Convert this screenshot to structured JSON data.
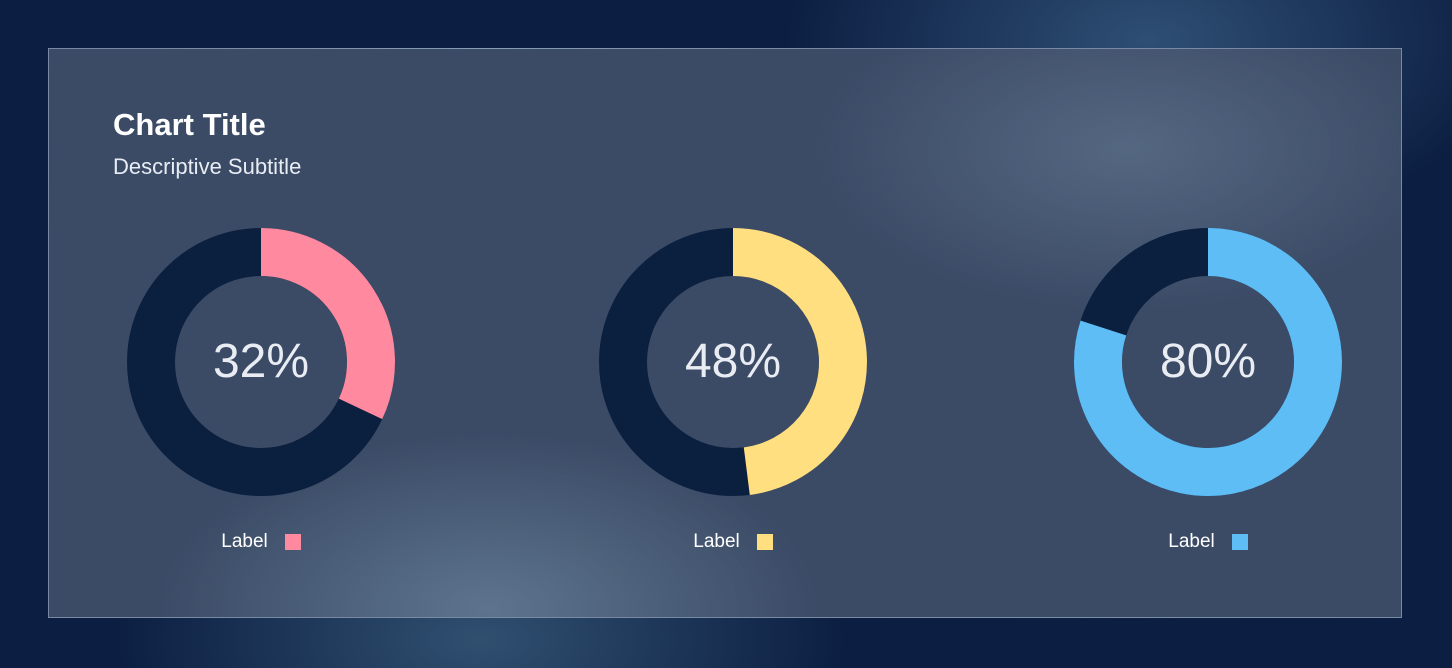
{
  "chart_data": {
    "type": "pie",
    "title": "Chart Title",
    "subtitle": "Descriptive Subtitle",
    "track_color": "#0b1f3f",
    "donuts": [
      {
        "value": 32,
        "display": "32%",
        "label": "Label",
        "color": "#ff8aa0"
      },
      {
        "value": 48,
        "display": "48%",
        "label": "Label",
        "color": "#ffdf80"
      },
      {
        "value": 80,
        "display": "80%",
        "label": "Label",
        "color": "#5fbdf5"
      }
    ]
  }
}
